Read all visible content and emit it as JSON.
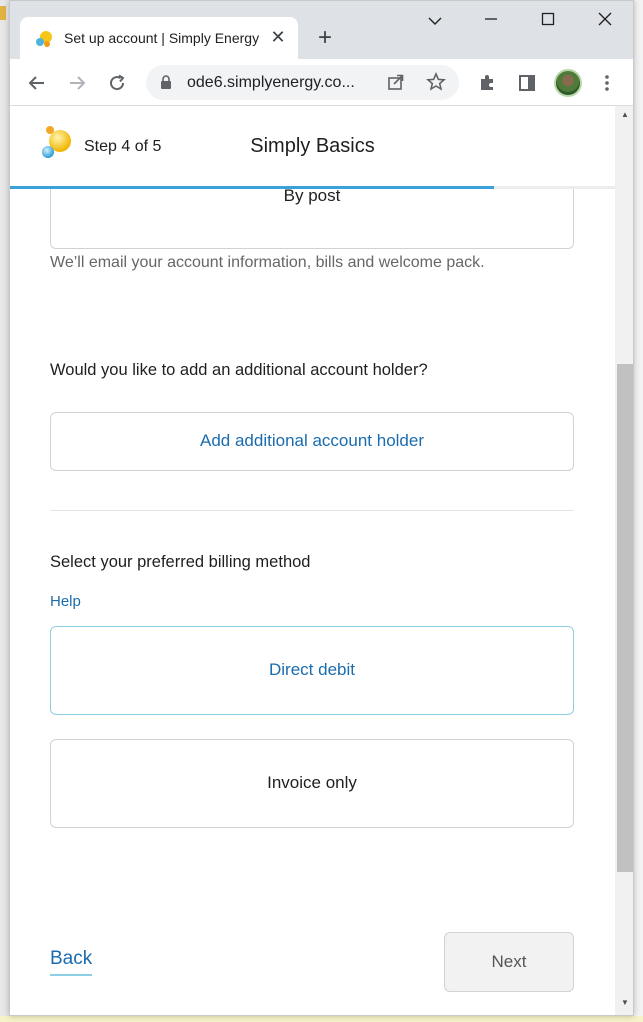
{
  "browser": {
    "tab_title": "Set up account | Simply Energy",
    "tab_close": "✕",
    "new_tab": "+",
    "url": "ode6.simplyenergy.co...",
    "icons": [
      "back-arrow-icon",
      "forward-arrow-icon",
      "reload-icon",
      "lock-icon",
      "share-icon",
      "star-icon",
      "extensions-icon",
      "side-panel-icon",
      "kebab-menu-icon"
    ]
  },
  "header": {
    "step": "Step 4 of 5",
    "plan": "Simply Basics",
    "progress_fraction": 0.8,
    "accent_color": "#3aa2d8"
  },
  "delivery": {
    "selected_option": "By post",
    "helper": "We’ll email your account information, bills and welcome pack."
  },
  "additional_holder": {
    "question": "Would you like to add an additional account holder?",
    "button": "Add additional account holder"
  },
  "billing": {
    "question": "Select your preferred billing method",
    "help": "Help",
    "options": [
      "Direct debit",
      "Invoice only"
    ]
  },
  "nav": {
    "back": "Back",
    "next": "Next"
  },
  "colors": {
    "link": "#1a6cae",
    "selected_border": "#8fcfe3"
  }
}
